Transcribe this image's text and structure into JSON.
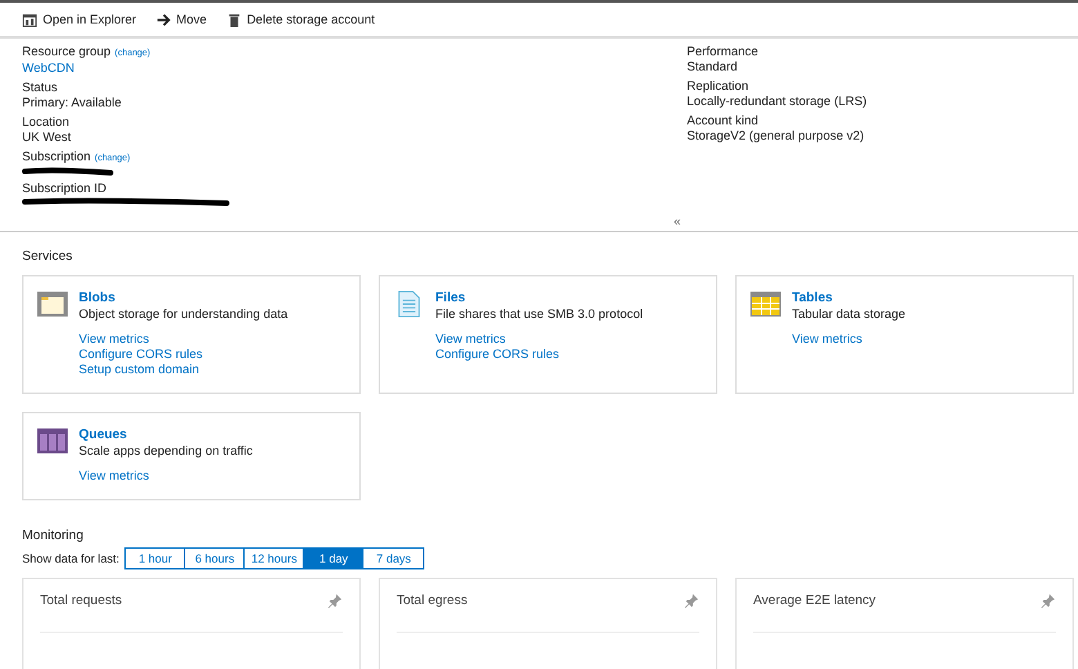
{
  "toolbar": [
    {
      "kind": "explorer",
      "label": "Open in Explorer"
    },
    {
      "kind": "move",
      "label": "Move"
    },
    {
      "kind": "delete",
      "label": "Delete storage account"
    }
  ],
  "essentials": {
    "left": [
      {
        "kind": "link",
        "label": "Resource group",
        "change": "(change)",
        "value": "WebCDN"
      },
      {
        "kind": "text",
        "label": "Status",
        "value": "Primary: Available"
      },
      {
        "kind": "text",
        "label": "Location",
        "value": "UK West"
      },
      {
        "kind": "redacted",
        "label": "Subscription",
        "change": "(change)"
      },
      {
        "kind": "redacted",
        "label": "Subscription ID"
      }
    ],
    "right": [
      {
        "kind": "text",
        "label": "Performance",
        "value": "Standard"
      },
      {
        "kind": "text",
        "label": "Replication",
        "value": "Locally-redundant storage (LRS)"
      },
      {
        "kind": "text",
        "label": "Account kind",
        "value": "StorageV2 (general purpose v2)"
      }
    ],
    "collapse": "«"
  },
  "services": {
    "title": "Services",
    "cards": [
      {
        "kind": "blob",
        "title": "Blobs",
        "description": "Object storage for understanding data",
        "links": [
          "View metrics",
          "Configure CORS rules",
          "Setup custom domain"
        ]
      },
      {
        "kind": "file",
        "title": "Files",
        "description": "File shares that use SMB 3.0 protocol",
        "links": [
          "View metrics",
          "Configure CORS rules"
        ]
      },
      {
        "kind": "table",
        "title": "Tables",
        "description": "Tabular data storage",
        "links": [
          "View metrics"
        ]
      },
      {
        "kind": "queue",
        "title": "Queues",
        "description": "Scale apps depending on traffic",
        "links": [
          "View metrics"
        ]
      }
    ]
  },
  "monitoring": {
    "title": "Monitoring",
    "range_label": "Show data for last:",
    "ranges": [
      {
        "label": "1 hour",
        "selected": false
      },
      {
        "label": "6 hours",
        "selected": false
      },
      {
        "label": "12 hours",
        "selected": false
      },
      {
        "label": "1 day",
        "selected": true
      },
      {
        "label": "7 days",
        "selected": false
      }
    ],
    "metrics": [
      {
        "title": "Total requests"
      },
      {
        "title": "Total egress"
      },
      {
        "title": "Average E2E latency"
      }
    ]
  }
}
